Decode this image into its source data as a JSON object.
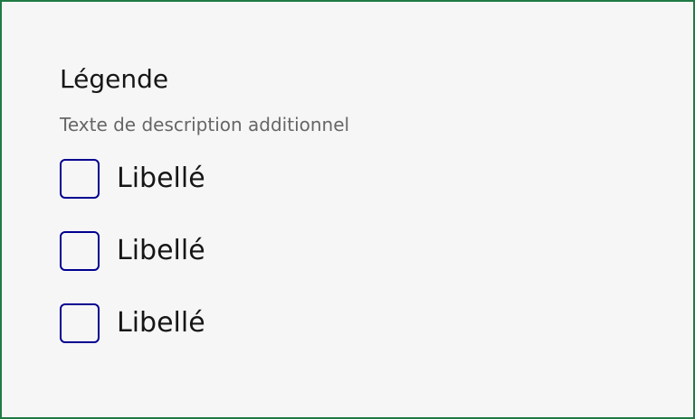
{
  "form": {
    "legend": "Légende",
    "hint": "Texte de description additionnel",
    "options": [
      {
        "label": "Libellé",
        "checked": false
      },
      {
        "label": "Libellé",
        "checked": false
      },
      {
        "label": "Libellé",
        "checked": false
      }
    ]
  },
  "colors": {
    "frame_border": "#1f7a43",
    "background": "#f6f6f6",
    "checkbox_border": "#000091",
    "text_primary": "#161616",
    "text_hint": "#666666"
  }
}
